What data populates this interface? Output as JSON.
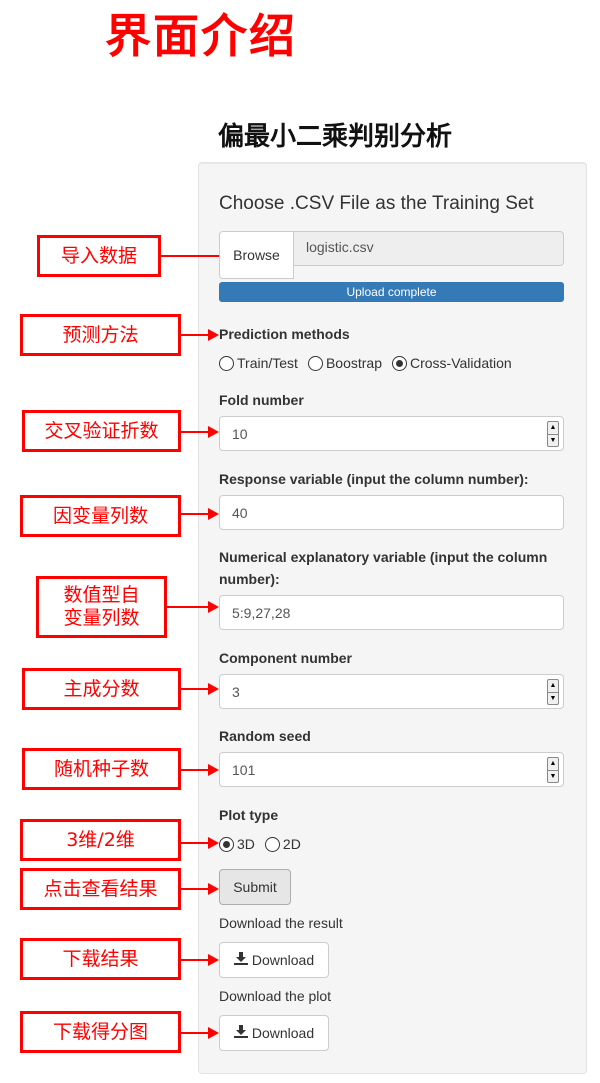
{
  "header": {
    "page_title": "界面介绍",
    "app_title": "偏最小二乘判别分析"
  },
  "file_input": {
    "label": "Choose .CSV File as the Training Set",
    "browse_label": "Browse",
    "file_name": "logistic.csv",
    "progress_text": "Upload complete",
    "progress": 1.0
  },
  "prediction": {
    "label": "Prediction methods",
    "options": [
      "Train/Test",
      "Boostrap",
      "Cross-Validation"
    ],
    "selected": "Cross-Validation"
  },
  "fold_number": {
    "label": "Fold number",
    "value": "10"
  },
  "response_variable": {
    "label": "Response variable (input the column number):",
    "value": "40"
  },
  "numerical_variable": {
    "label_line1": "Numerical explanatory variable (input the column",
    "label_line2": "number):",
    "value": "5:9,27,28"
  },
  "component_number": {
    "label": "Component number",
    "value": "3"
  },
  "random_seed": {
    "label": "Random seed",
    "value": "101"
  },
  "plot_type": {
    "label": "Plot type",
    "options": [
      "3D",
      "2D"
    ],
    "selected": "3D"
  },
  "submit": {
    "label": "Submit"
  },
  "download_result": {
    "label": "Download the result",
    "button": "Download"
  },
  "download_plot": {
    "label": "Download the plot",
    "button": "Download"
  },
  "annotations": {
    "import_data": "导入数据",
    "predict_method": "预测方法",
    "cv_folds": "交叉验证折数",
    "response_col": "因变量列数",
    "numeric_cols_line1": "数值型自",
    "numeric_cols_line2": "变量列数",
    "components": "主成分数",
    "random_seed": "随机种子数",
    "dimension": "3维/2维",
    "click_results": "点击查看结果",
    "download_results": "下载结果",
    "download_score_plot": "下载得分图"
  },
  "colors": {
    "annotation": "#ff0000",
    "progress": "#337ab7",
    "title": "#ff0000"
  }
}
